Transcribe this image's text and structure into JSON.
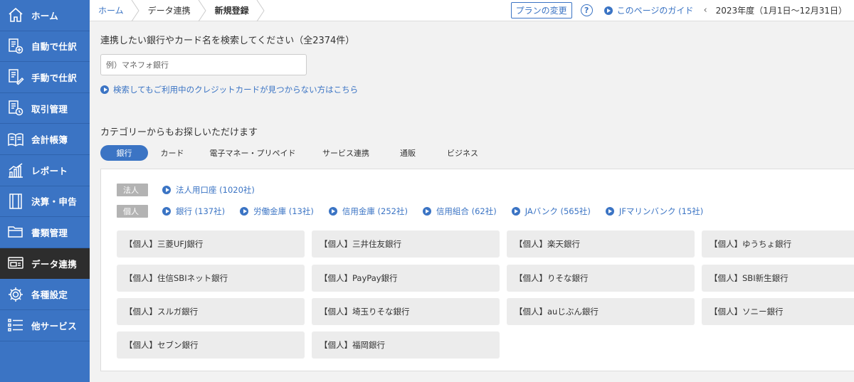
{
  "sidebar": {
    "items": [
      {
        "label": "ホーム",
        "icon": "home-icon"
      },
      {
        "label": "自動で仕訳",
        "icon": "auto-journal-icon"
      },
      {
        "label": "手動で仕訳",
        "icon": "manual-journal-icon"
      },
      {
        "label": "取引管理",
        "icon": "transaction-icon"
      },
      {
        "label": "会計帳簿",
        "icon": "ledger-book-icon"
      },
      {
        "label": "レポート",
        "icon": "report-chart-icon"
      },
      {
        "label": "決算・申告",
        "icon": "settlement-icon"
      },
      {
        "label": "書類管理",
        "icon": "folder-icon"
      },
      {
        "label": "データ連携",
        "icon": "data-link-icon"
      },
      {
        "label": "各種設定",
        "icon": "gear-icon"
      },
      {
        "label": "他サービス",
        "icon": "list-icon"
      }
    ]
  },
  "header": {
    "breadcrumb": [
      "ホーム",
      "データ連携",
      "新規登録"
    ],
    "plan_button": "プランの変更",
    "help": "?",
    "guide": "このページのガイド",
    "fiscal_prev": "‹",
    "fiscal_year": "2023年度（1月1日〜12月31日）"
  },
  "search": {
    "title": "連携したい銀行やカード名を検索してください（全2374件）",
    "placeholder": "例）マネフォ銀行",
    "not_found_link": "検索してもご利用中のクレジットカードが見つからない方はこちら"
  },
  "category": {
    "title": "カテゴリーからもお探しいただけます",
    "tabs": [
      "銀行",
      "カード",
      "電子マネー・プリペイド",
      "サービス連携",
      "通販",
      "ビジネス"
    ],
    "active_tab": "銀行"
  },
  "filters": {
    "corporate_tag": "法人",
    "corporate_links": [
      "法人用口座 (1020社)"
    ],
    "personal_tag": "個人",
    "personal_links": [
      "銀行 (137社)",
      "労働金庫 (13社)",
      "信用金庫 (252社)",
      "信用組合 (62社)",
      "JAバンク (565社)",
      "JFマリンバンク (15社)"
    ]
  },
  "banks": [
    "【個人】三菱UFJ銀行",
    "【個人】三井住友銀行",
    "【個人】楽天銀行",
    "【個人】ゆうちょ銀行",
    "【個人】住信SBIネット銀行",
    "【個人】PayPay銀行",
    "【個人】りそな銀行",
    "【個人】SBI新生銀行",
    "【個人】スルガ銀行",
    "【個人】埼玉りそな銀行",
    "【個人】auじぶん銀行",
    "【個人】ソニー銀行",
    "【個人】セブン銀行",
    "【個人】福岡銀行"
  ],
  "colors": {
    "sidebar": "#3b74c4",
    "sidebar_active": "#2d2d2d",
    "accent": "#3b74c4"
  }
}
